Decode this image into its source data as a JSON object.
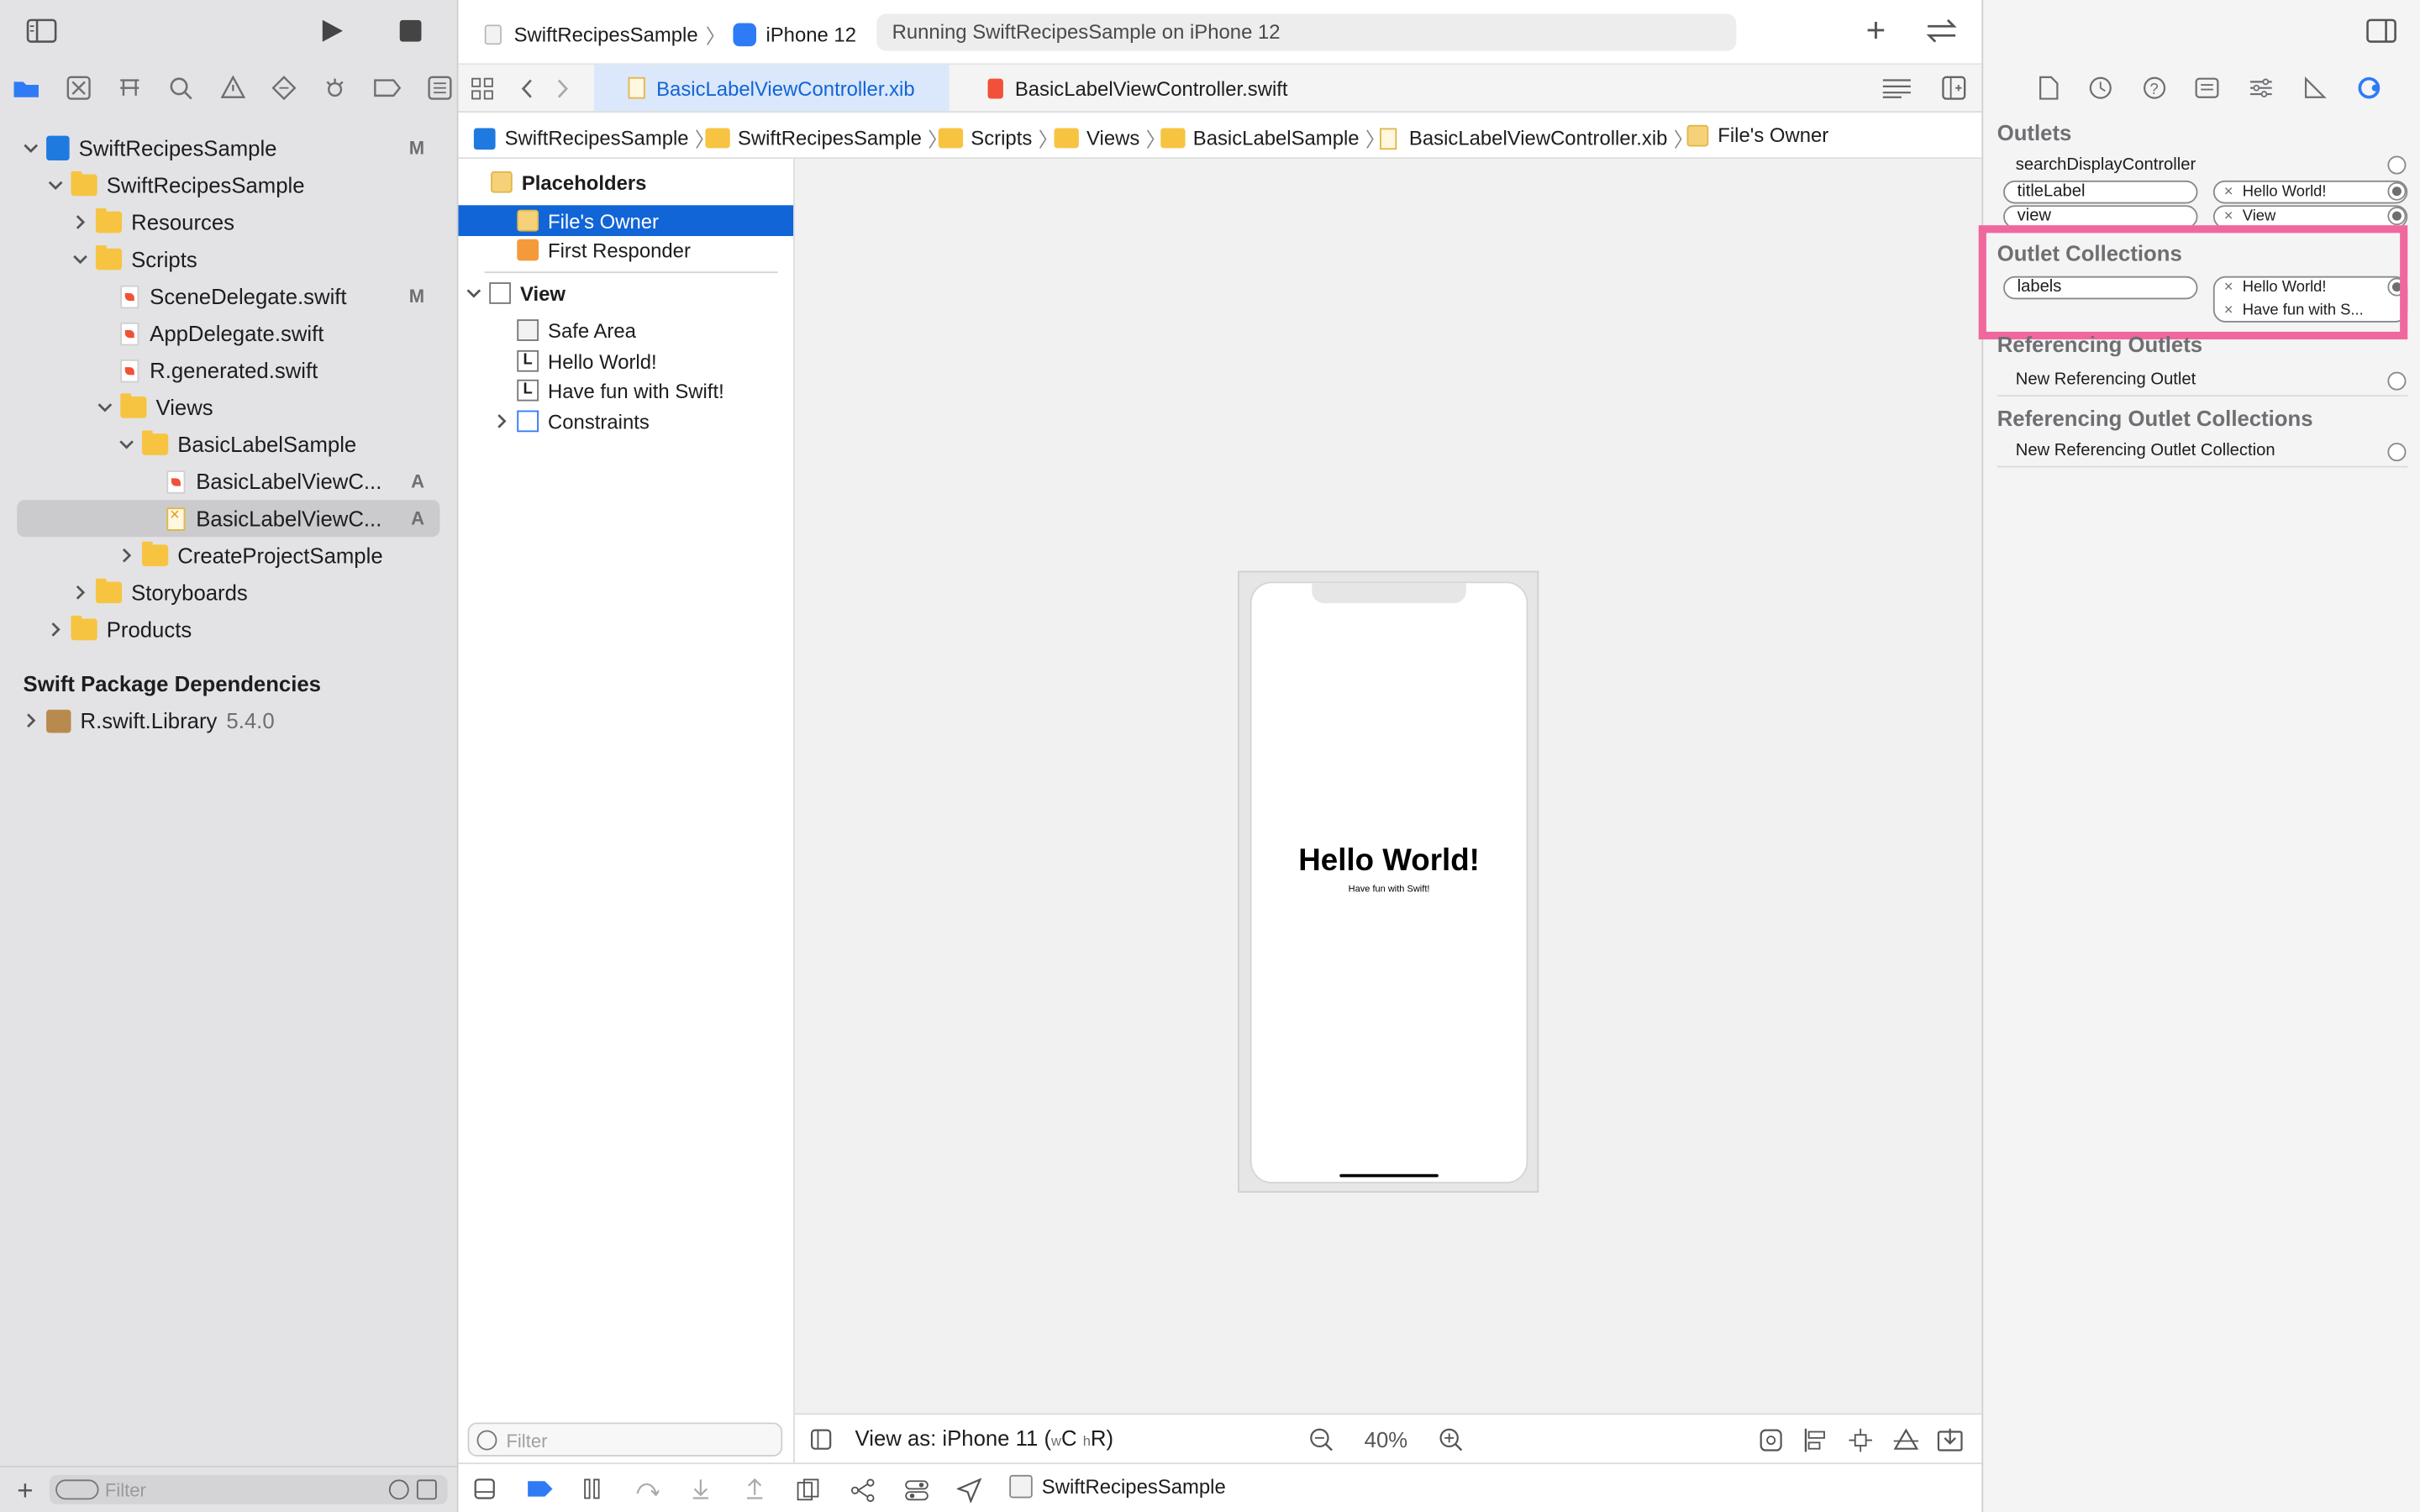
{
  "toolbar": {
    "scheme": "SwiftRecipesSample",
    "device": "iPhone 12",
    "status": "Running SwiftRecipesSample on iPhone 12"
  },
  "tabs": [
    {
      "label": "BasicLabelViewController.xib",
      "active": true
    },
    {
      "label": "BasicLabelViewController.swift",
      "active": false
    }
  ],
  "breadcrumb": [
    "SwiftRecipesSample",
    "SwiftRecipesSample",
    "Scripts",
    "Views",
    "BasicLabelSample",
    "BasicLabelViewController.xib",
    "File's Owner"
  ],
  "navigator": {
    "items": [
      {
        "label": "SwiftRecipesSample",
        "badge": "M"
      },
      {
        "label": "SwiftRecipesSample",
        "badge": ""
      },
      {
        "label": "Resources",
        "badge": ""
      },
      {
        "label": "Scripts",
        "badge": ""
      },
      {
        "label": "SceneDelegate.swift",
        "badge": "M"
      },
      {
        "label": "AppDelegate.swift",
        "badge": ""
      },
      {
        "label": "R.generated.swift",
        "badge": ""
      },
      {
        "label": "Views",
        "badge": ""
      },
      {
        "label": "BasicLabelSample",
        "badge": ""
      },
      {
        "label": "BasicLabelViewC...",
        "badge": "A"
      },
      {
        "label": "BasicLabelViewC...",
        "badge": "A"
      },
      {
        "label": "CreateProjectSample",
        "badge": ""
      },
      {
        "label": "Storyboards",
        "badge": ""
      },
      {
        "label": "Products",
        "badge": ""
      }
    ],
    "packages_header": "Swift Package Dependencies",
    "package": {
      "name": "R.swift.Library",
      "version": "5.4.0"
    },
    "filter_placeholder": "Filter"
  },
  "outline": {
    "placeholders": "Placeholders",
    "files_owner": "File's Owner",
    "first_responder": "First Responder",
    "view": "View",
    "children": [
      "Safe Area",
      "Hello World!",
      "Have fun with Swift!",
      "Constraints"
    ],
    "filter_placeholder": "Filter"
  },
  "canvas": {
    "title": "Hello World!",
    "subtitle": "Have fun with Swift!",
    "view_as_prefix": "View as: iPhone 11 (",
    "view_as_w": "w",
    "view_as_c": "C",
    "view_as_h": "h",
    "view_as_r": "R)",
    "zoom": "40%"
  },
  "bottom": {
    "target": "SwiftRecipesSample"
  },
  "inspector": {
    "outlets_header": "Outlets",
    "outlets": [
      {
        "name": "searchDisplayController",
        "target": ""
      },
      {
        "name": "titleLabel",
        "target": "Hello World!"
      },
      {
        "name": "view",
        "target": "View"
      }
    ],
    "collections_header": "Outlet Collections",
    "collection": {
      "name": "labels",
      "targets": [
        "Hello World!",
        "Have fun with S..."
      ]
    },
    "referencing_header": "Referencing Outlets",
    "new_referencing": "New Referencing Outlet",
    "ref_collections_header": "Referencing Outlet Collections",
    "new_ref_collection": "New Referencing Outlet Collection"
  },
  "colors": {
    "highlight": "#f0679e",
    "selection": "#1165d6",
    "accent": "#2f7bf5"
  }
}
